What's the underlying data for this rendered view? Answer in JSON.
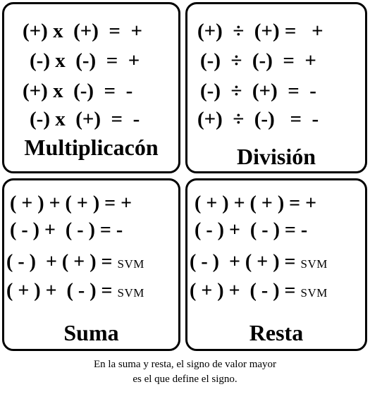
{
  "multiplicacion": {
    "title": "Multiplicacón",
    "rules": [
      "(+) x  (+)  =  +",
      "(-) x  (-)  =  +",
      "(+) x  (-)  =  -",
      "(-) x  (+)  =  -"
    ]
  },
  "division": {
    "title": "División",
    "rules": [
      "(+)  ÷  (+) =   +",
      "(-)  ÷  (-)  =  +",
      "(-)  ÷  (+)  =  -",
      "(+)  ÷  (-)   =  -"
    ]
  },
  "suma": {
    "title": "Suma",
    "rules": [
      {
        "text": "( + ) + ( + ) = +",
        "svm": ""
      },
      {
        "text": "( - ) +  ( - ) = -",
        "svm": ""
      },
      {
        "text": "( - )  + ( + ) = ",
        "svm": "SVM"
      },
      {
        "text": "( + ) +  ( - ) = ",
        "svm": "SVM"
      }
    ]
  },
  "resta": {
    "title": "Resta",
    "rules": [
      {
        "text": "( + ) + ( + ) = +",
        "svm": ""
      },
      {
        "text": "( - ) +  ( - ) = -",
        "svm": ""
      },
      {
        "text": "( - )  + ( + ) = ",
        "svm": "SVM"
      },
      {
        "text": "( + ) +  ( - ) = ",
        "svm": "SVM"
      }
    ]
  },
  "footer": {
    "line1": "En la suma y resta, el signo de valor mayor",
    "line2": "es el que define el signo."
  }
}
